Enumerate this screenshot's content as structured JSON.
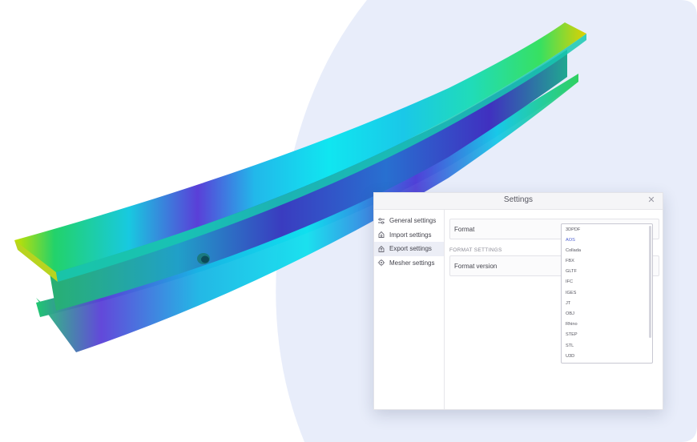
{
  "dialog": {
    "title": "Settings",
    "close_glyph": "✕",
    "sidebar": [
      {
        "label": "General settings",
        "icon": "sliders-icon"
      },
      {
        "label": "Import settings",
        "icon": "import-icon"
      },
      {
        "label": "Export settings",
        "icon": "export-icon",
        "active": true
      },
      {
        "label": "Mesher settings",
        "icon": "gear-icon"
      }
    ],
    "format_label": "Format",
    "section_title": "FORMAT SETTINGS",
    "format_version_label": "Format version"
  },
  "dropdown": {
    "selected": "AOS",
    "options": [
      "3DPDF",
      "AOS",
      "Collada",
      "FBX",
      "GLTF",
      "IFC",
      "IGES",
      "JT",
      "OBJ",
      "Rhino",
      "STEP",
      "STL",
      "U3D"
    ]
  },
  "colors": {
    "accent": "#4c5fd0",
    "background_shape": "#e8edfa"
  }
}
